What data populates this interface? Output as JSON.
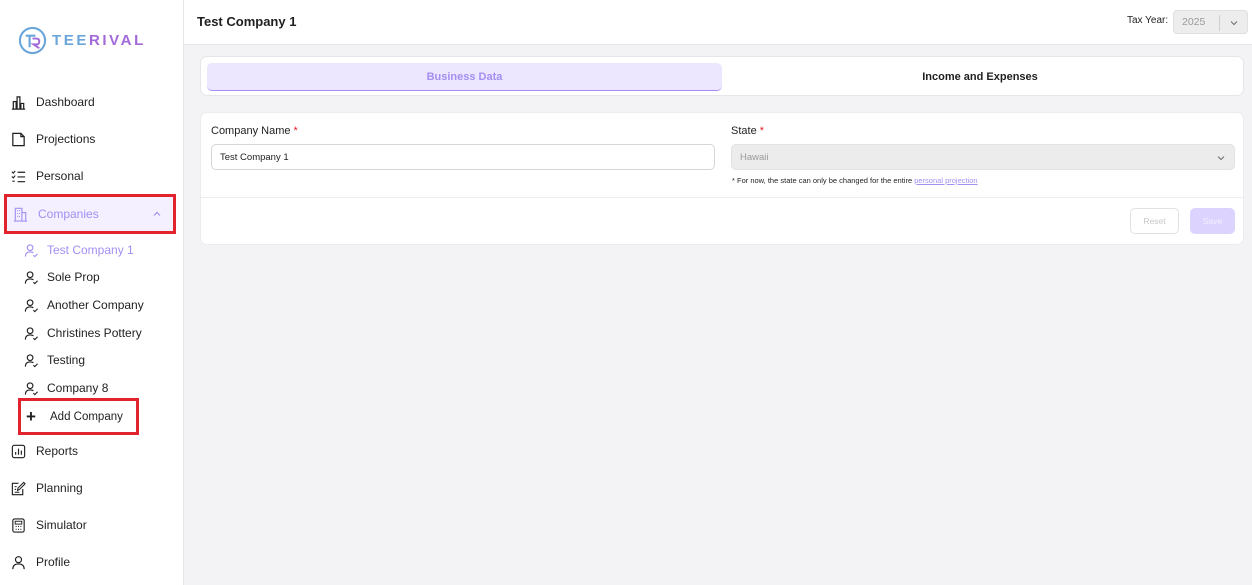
{
  "brand": {
    "logo_text_a": "TEE",
    "logo_text_b": "RIVAL"
  },
  "sidebar": {
    "dashboard": "Dashboard",
    "projections": "Projections",
    "personal": "Personal",
    "companies": "Companies",
    "companies_list": [
      "Test Company 1",
      "Sole Prop",
      "Another Company",
      "Christines Pottery",
      "Testing",
      "Company 8"
    ],
    "add_company": "Add Company",
    "reports": "Reports",
    "planning": "Planning",
    "simulator": "Simulator",
    "profile": "Profile"
  },
  "header": {
    "title": "Test Company 1",
    "tax_year_label": "Tax Year:",
    "tax_year_value": "2025"
  },
  "tabs": {
    "business": "Business Data",
    "income": "Income and Expenses"
  },
  "form": {
    "company_name_label": "Company Name",
    "company_name_value": "Test Company 1",
    "state_label": "State",
    "required_mark": "*",
    "state_value": "Hawaii",
    "note_text": "* For now, the state can only be changed for the entire",
    "note_link": "personal projection",
    "reset_label": "Reset",
    "save_label": "Save"
  },
  "colors": {
    "accent": "#a48ff2",
    "accent_bg": "#ece6ff",
    "highlight": "#e1232d"
  }
}
